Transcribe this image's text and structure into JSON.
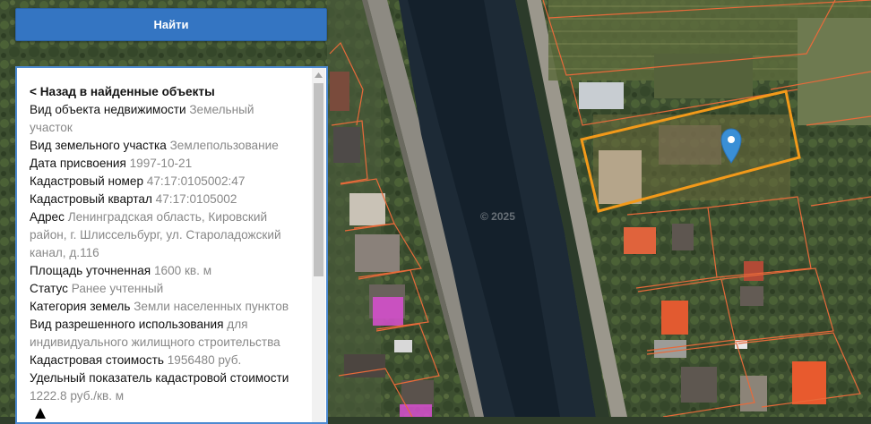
{
  "search": {
    "button_label": "Найти"
  },
  "details": {
    "back_link": "< Назад в найденные объекты",
    "rows": [
      {
        "label": "Вид объекта недвижимости",
        "value": "Земельный участок"
      },
      {
        "label": "Вид земельного участка",
        "value": "Землепользование"
      },
      {
        "label": "Дата присвоения",
        "value": "1997-10-21"
      },
      {
        "label": "Кадастровый номер",
        "value": "47:17:0105002:47"
      },
      {
        "label": "Кадастровый квартал",
        "value": "47:17:0105002"
      },
      {
        "label": "Адрес",
        "value": "Ленинградская область, Кировский район, г. Шлиссельбург, ул. Староладожский канал, д.116"
      },
      {
        "label": "Площадь уточненная",
        "value": "1600 кв. м"
      },
      {
        "label": "Статус",
        "value": "Ранее учтенный"
      },
      {
        "label": "Категория земель",
        "value": "Земли населенных пунктов"
      },
      {
        "label": "Вид разрешенного использования",
        "value": "для индивидуального жилищного строительства"
      },
      {
        "label": "Кадастровая стоимость",
        "value": "1956480 руб."
      },
      {
        "label": "Удельный показатель кадастровой стоимости",
        "value": "1222.8 руб./кв. м"
      }
    ]
  },
  "map": {
    "watermark": "© 2025",
    "colors": {
      "parcel_outline": "#e86a3a",
      "selected_parcel": "#f39a1a",
      "marker": "#3a8fd6",
      "building_highlight": "#d94fd1"
    }
  }
}
